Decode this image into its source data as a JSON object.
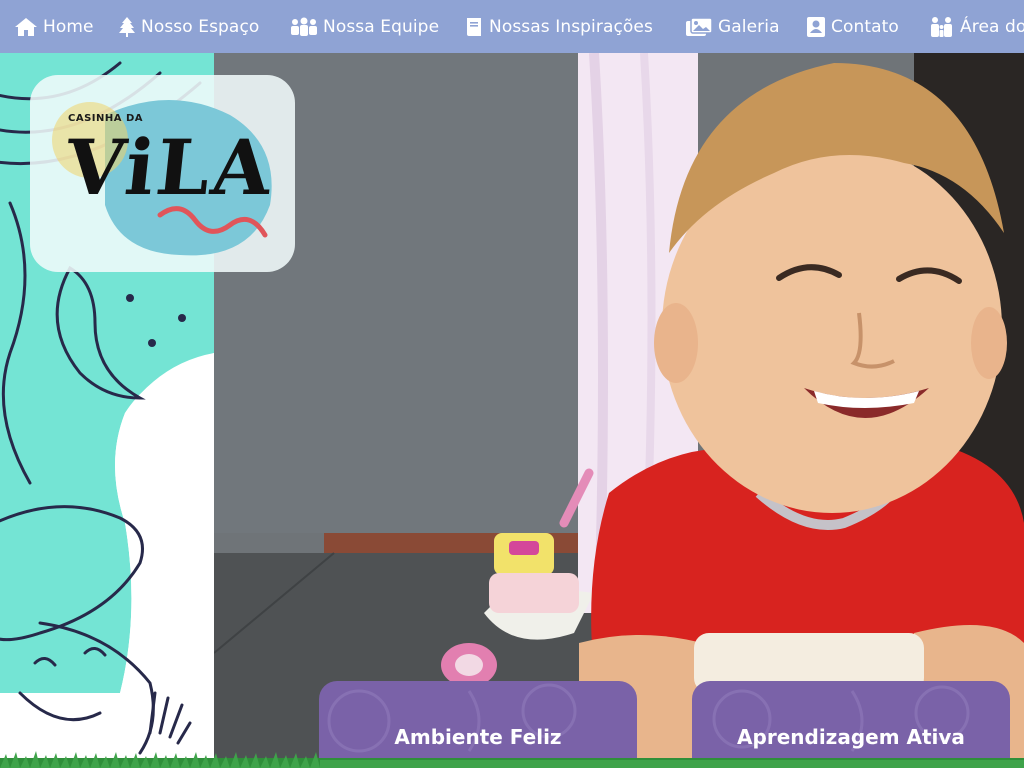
{
  "nav": {
    "items": [
      {
        "label": "Home",
        "icon": "home-icon"
      },
      {
        "label": "Nosso Espaço",
        "icon": "tree-icon"
      },
      {
        "label": "Nossa Equipe",
        "icon": "people-icon"
      },
      {
        "label": "Nossas Inspirações",
        "icon": "book-icon"
      },
      {
        "label": "Galeria",
        "icon": "images-icon"
      },
      {
        "label": "Contato",
        "icon": "contact-card-icon"
      },
      {
        "label": "Área do",
        "icon": "family-icon"
      }
    ]
  },
  "logo": {
    "line1": "CASINHA DA",
    "line2": "ViLA"
  },
  "cards": [
    {
      "title": "Ambiente Feliz"
    },
    {
      "title": "Aprendizagem Ativa"
    }
  ],
  "colors": {
    "nav_bg": "#8fa3d4",
    "card_bg": "#7a62a8",
    "mint": "#74e4d4",
    "shirt_red": "#d8231f",
    "logo_blob": "#7cc8d8"
  }
}
